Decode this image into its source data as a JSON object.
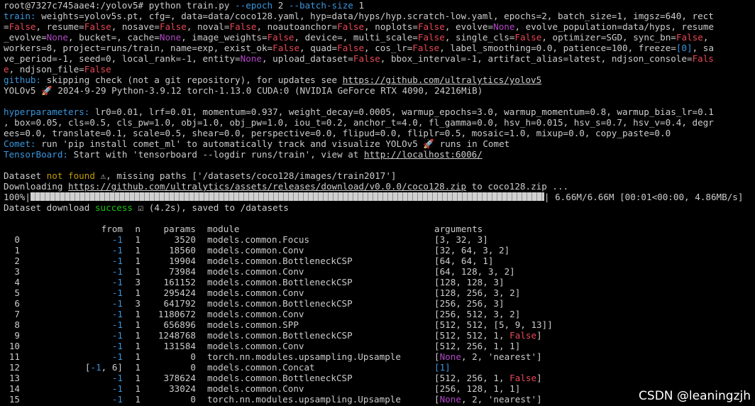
{
  "terminal": {
    "prompt": "root@7327c745aae4:/yolov5# ",
    "cmd_main": "python train.py ",
    "cmd_arg1": "--epoch",
    "cmd_mid": " 2 ",
    "cmd_arg2": "--batch-size",
    "cmd_end": " 1",
    "train_label": "train:",
    "args_1a": " weights=yolov5s.pt, cfg=, data=data/coco128.yaml, hyp=data/hyps/hyp.scratch-low.yaml, epochs=2, batch_size=1, imgsz=640, rect",
    "args_2a": "=",
    "args_2b": ", resume=",
    "args_2c": ", nosave=",
    "args_2d": ", noval=",
    "args_2e": ", noautoanchor=",
    "args_2f": ", noplots=",
    "args_2g": ", evolve=",
    "args_2h": ", evolve_population=data/hyps, resume",
    "args_3a": "_evolve=",
    "args_3b": ", bucket=, cache=",
    "args_3c": ", image_weights=",
    "args_3d": ", device=, multi_scale=",
    "args_3e": ", single_cls=",
    "args_3f": ", optimizer=SGD, sync_bn=",
    "args_3g": ",",
    "args_4a": "workers=8, project=runs/train, name=exp, exist_ok=",
    "args_4b": ", quad=",
    "args_4c": ", cos_lr=",
    "args_4d": ", label_smoothing=0.0, patience=100, freeze=",
    "args_4e": "[0]",
    "args_4f": ", sa",
    "args_5a": "ve_period=-1, seed=0, local_rank=-1, entity=",
    "args_5b": ", upload_dataset=",
    "args_5c": ", bbox_interval=-1, artifact_alias=latest, ndjson_console=",
    "args_5d": "Fals",
    "args_6a": "e",
    "args_6b": ", ndjson_file=",
    "kw_false": "False",
    "kw_none": "None",
    "github_label": "github:",
    "github_text": " skipping check (not a git repository), for updates see ",
    "github_link": "https://github.com/ultralytics/yolov5",
    "version_line": "YOLOv5 🚀 2024-9-29 Python-3.9.12 torch-1.13.0 CUDA:0 (NVIDIA GeForce RTX 4090, 24216MiB)",
    "hyp_label": "hyperparameters:",
    "hyp_1": " lr0=0.01, lrf=0.01, momentum=0.937, weight_decay=0.0005, warmup_epochs=3.0, warmup_momentum=0.8, warmup_bias_lr=0.1",
    "hyp_2": ", box=0.05, cls=0.5, cls_pw=1.0, obj=1.0, obj_pw=1.0, iou_t=0.2, anchor_t=4.0, fl_gamma=0.0, hsv_h=0.015, hsv_s=0.7, hsv_v=0.4, degr",
    "hyp_3": "ees=0.0, translate=0.1, scale=0.5, shear=0.0, perspective=0.0, flipud=0.0, fliplr=0.5, mosaic=1.0, mixup=0.0, copy_paste=0.0",
    "comet_label": "Comet:",
    "comet_text": " run 'pip install comet_ml' to automatically track and visualize YOLOv5 🚀 runs in Comet",
    "tb_label": "TensorBoard:",
    "tb_text": " Start with 'tensorboard --logdir runs/train', view at ",
    "tb_link": "http://localhost:6006/",
    "ds_a": "Dataset ",
    "ds_notfound": "not found",
    "ds_b": " ⚠, missing paths ['/datasets/coco128/images/train2017']",
    "dl_a": "Downloading ",
    "dl_link": "https://github.com/ultralytics/assets/releases/download/v0.0.0/coco128.zip",
    "dl_b": " to coco128.zip ...",
    "progress_pct": "100%|",
    "progress_fraction": 1.0,
    "progress_tail": "| 6.66M/6.66M [00:01<00:00, 4.86MB/s]",
    "ds_ok_a": "Dataset download ",
    "ds_ok_success": "success",
    "ds_ok_b": " ☑ (4.2s), saved to /datasets"
  },
  "model_table": {
    "headers": [
      "from",
      "n",
      "params",
      "module",
      "arguments"
    ],
    "rows": [
      {
        "idx": "0",
        "from": "-1",
        "n": "1",
        "params": "3520",
        "module": "models.common.Focus",
        "args": "[3, 32, 3]"
      },
      {
        "idx": "1",
        "from": "-1",
        "n": "1",
        "params": "18560",
        "module": "models.common.Conv",
        "args": "[32, 64, 3, 2]"
      },
      {
        "idx": "2",
        "from": "-1",
        "n": "1",
        "params": "19904",
        "module": "models.common.BottleneckCSP",
        "args": "[64, 64, 1]"
      },
      {
        "idx": "3",
        "from": "-1",
        "n": "1",
        "params": "73984",
        "module": "models.common.Conv",
        "args": "[64, 128, 3, 2]"
      },
      {
        "idx": "4",
        "from": "-1",
        "n": "3",
        "params": "161152",
        "module": "models.common.BottleneckCSP",
        "args": "[128, 128, 3]"
      },
      {
        "idx": "5",
        "from": "-1",
        "n": "1",
        "params": "295424",
        "module": "models.common.Conv",
        "args": "[128, 256, 3, 2]"
      },
      {
        "idx": "6",
        "from": "-1",
        "n": "3",
        "params": "641792",
        "module": "models.common.BottleneckCSP",
        "args": "[256, 256, 3]"
      },
      {
        "idx": "7",
        "from": "-1",
        "n": "1",
        "params": "1180672",
        "module": "models.common.Conv",
        "args": "[256, 512, 3, 2]"
      },
      {
        "idx": "8",
        "from": "-1",
        "n": "1",
        "params": "656896",
        "module": "models.common.SPP",
        "args": "[512, 512, [5, 9, 13]]"
      },
      {
        "idx": "9",
        "from": "-1",
        "n": "1",
        "params": "1248768",
        "module": "models.common.BottleneckCSP",
        "args": "[512, 512, 1, False]"
      },
      {
        "idx": "10",
        "from": "-1",
        "n": "1",
        "params": "131584",
        "module": "models.common.Conv",
        "args": "[512, 256, 1, 1]"
      },
      {
        "idx": "11",
        "from": "-1",
        "n": "1",
        "params": "0",
        "module": "torch.nn.modules.upsampling.Upsample",
        "args": "[None, 2, 'nearest']"
      },
      {
        "idx": "12",
        "from": "[-1, 6]",
        "n": "1",
        "params": "0",
        "module": "models.common.Concat",
        "args": "[1]"
      },
      {
        "idx": "13",
        "from": "-1",
        "n": "1",
        "params": "378624",
        "module": "models.common.BottleneckCSP",
        "args": "[512, 256, 1, False]"
      },
      {
        "idx": "14",
        "from": "-1",
        "n": "1",
        "params": "33024",
        "module": "models.common.Conv",
        "args": "[256, 128, 1, 1]"
      },
      {
        "idx": "15",
        "from": "-1",
        "n": "1",
        "params": "0",
        "module": "torch.nn.modules.upsampling.Upsample",
        "args": "[None, 2, 'nearest']"
      }
    ]
  },
  "watermark": "CSDN @leaningzjh",
  "colors": {
    "cyan": "#3a96dd",
    "red": "#e74856",
    "magenta": "#b148c6",
    "green": "#16c60c",
    "yellow": "#c19c00"
  }
}
